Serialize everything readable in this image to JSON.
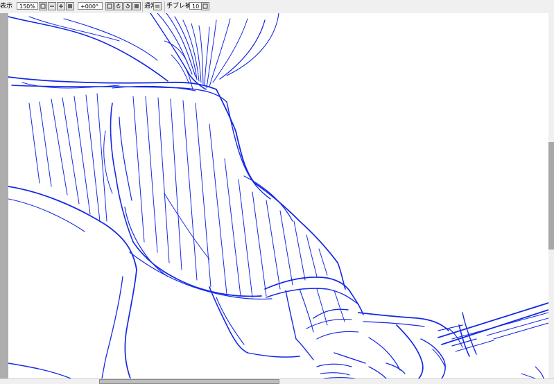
{
  "toolbar": {
    "display_label": "表示",
    "zoom_value": "150%",
    "rotation_value": "+000°",
    "blend_mode": "通常",
    "stabilizer_label": "手ブレ補正",
    "stabilizer_value": "10"
  },
  "canvas": {
    "stroke_color": "#1428e6",
    "background": "#ffffff"
  },
  "icons": [
    "zoom-dropdown-icon",
    "zoom-out-icon",
    "zoom-in-icon",
    "zoom-fit-icon",
    "rotation-dropdown-icon",
    "rotate-ccw-icon",
    "rotate-cw-icon",
    "rotate-reset-icon",
    "blend-mode-icon",
    "stabilizer-dropdown-icon"
  ]
}
